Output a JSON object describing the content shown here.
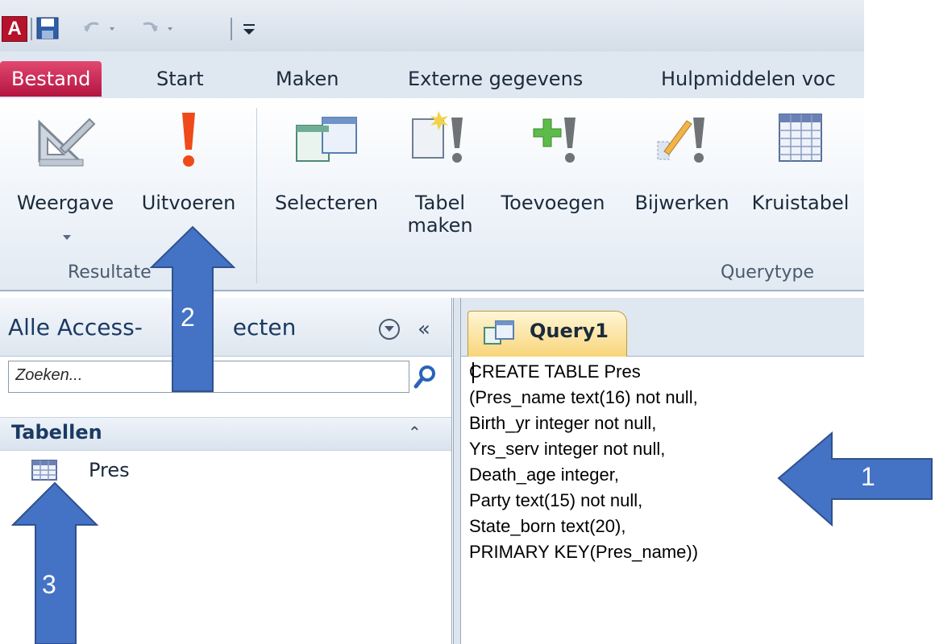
{
  "qat": {
    "logo_letter": "A",
    "icons": [
      "access-logo-icon",
      "save-icon",
      "undo-icon",
      "redo-icon",
      "customize-toolbar-icon"
    ]
  },
  "tabs": [
    "Bestand",
    "Start",
    "Maken",
    "Externe gegevens",
    "Hulpmiddelen voc"
  ],
  "ribbon": {
    "view_label": "Weergave",
    "run_label": "Uitvoeren",
    "results_group": "Resultate",
    "select_label": "Selecteren",
    "make_table_label1": "Tabel",
    "make_table_label2": "maken",
    "append_label": "Toevoegen",
    "update_label": "Bijwerken",
    "crosstab_label": "Kruistabel",
    "querytype_group": "Querytype"
  },
  "nav": {
    "title": "Alle Access-",
    "title_suffix": "ecten",
    "collapse": "«",
    "search_placeholder": "Zoeken...",
    "category": "Tabellen",
    "category_chevron": "⌃",
    "items": [
      {
        "label": "Pres"
      }
    ]
  },
  "doc": {
    "tab_label": "Query1",
    "sql_lines": [
      "CREATE TABLE Pres",
      "(Pres_name text(16) not null,",
      "Birth_yr integer not null,",
      "Yrs_serv integer not null,",
      "Death_age integer,",
      "Party text(15) not null,",
      "State_born text(20),",
      "PRIMARY KEY(Pres_name))"
    ]
  },
  "callouts": [
    "1",
    "2",
    "3"
  ],
  "colors": {
    "accent": "#b3143f",
    "arrow": "#4472c4",
    "arrow_border": "#2f528f"
  }
}
